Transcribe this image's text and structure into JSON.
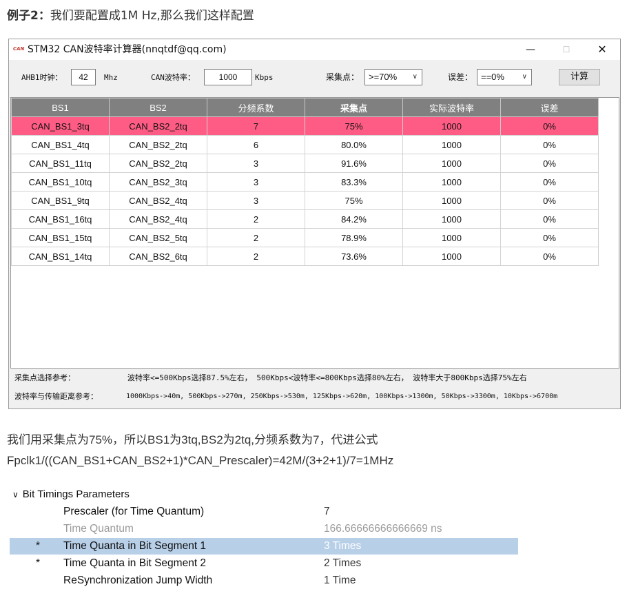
{
  "heading": {
    "bold": "例子2：",
    "text": "我们要配置成1M Hz,那么我们这样配置"
  },
  "window": {
    "logo": "CAN",
    "title": "STM32 CAN波特率计算器(nnqtdf@qq.com)",
    "controls": {
      "minimize": "—",
      "maximize": "☐",
      "close": "✕"
    },
    "ahb_label": "AHB1时钟：",
    "ahb_value": "42",
    "ahb_unit": "Mhz",
    "baud_label": "CAN波特率：",
    "baud_value": "1000",
    "baud_unit": "Kbps",
    "sample_label": "采集点：",
    "sample_value": ">=70%",
    "error_label": "误差：",
    "error_value": "==0%",
    "calc_button": "计算",
    "table": {
      "headers": [
        "BS1",
        "BS2",
        "分频系数",
        "采集点",
        "实际波特率",
        "误差"
      ],
      "rows": [
        [
          "CAN_BS1_3tq",
          "CAN_BS2_2tq",
          "7",
          "75%",
          "1000",
          "0%"
        ],
        [
          "CAN_BS1_4tq",
          "CAN_BS2_2tq",
          "6",
          "80.0%",
          "1000",
          "0%"
        ],
        [
          "CAN_BS1_11tq",
          "CAN_BS2_2tq",
          "3",
          "91.6%",
          "1000",
          "0%"
        ],
        [
          "CAN_BS1_10tq",
          "CAN_BS2_3tq",
          "3",
          "83.3%",
          "1000",
          "0%"
        ],
        [
          "CAN_BS1_9tq",
          "CAN_BS2_4tq",
          "3",
          "75%",
          "1000",
          "0%"
        ],
        [
          "CAN_BS1_16tq",
          "CAN_BS2_4tq",
          "2",
          "84.2%",
          "1000",
          "0%"
        ],
        [
          "CAN_BS1_15tq",
          "CAN_BS2_5tq",
          "2",
          "78.9%",
          "1000",
          "0%"
        ],
        [
          "CAN_BS1_14tq",
          "CAN_BS2_6tq",
          "2",
          "73.6%",
          "1000",
          "0%"
        ]
      ],
      "selected_row": 0,
      "selected_color": "#ff5c85"
    },
    "footer": {
      "sample_ref_label": "采集点选择参考：",
      "sample_ref_text": "波特率<=500Kbps选择87.5%左右，  500Kbps<波特率<=800Kbps选择80%左右，  波特率大于800Kbps选择75%左右",
      "distance_ref_label": "波特率与传输距离参考：",
      "distance_ref_text": "1000Kbps->40m, 500Kbps->270m, 250Kbps->530m, 125Kbps->620m, 100Kbps->1300m, 50Kbps->3300m, 10Kbps->6700m"
    }
  },
  "explanation": {
    "line1": "我们用采集点为75%，所以BS1为3tq,BS2为2tq,分频系数为7，代进公式",
    "line2": "Fpclk1/((CAN_BS1+CAN_BS2+1)*CAN_Prescaler)=42M/(3+2+1)/7=1MHz"
  },
  "properties": {
    "group_title": "Bit Timings Parameters",
    "rows": [
      {
        "star": "",
        "name": "Prescaler (for Time Quantum)",
        "value": "7",
        "dim": false,
        "highlight": false
      },
      {
        "star": "",
        "name": "Time Quantum",
        "value": "166.66666666666669 ns",
        "dim": true,
        "highlight": false
      },
      {
        "star": "*",
        "name": "Time Quanta in Bit Segment 1",
        "value": "3 Times",
        "dim": false,
        "highlight": true
      },
      {
        "star": "*",
        "name": "Time Quanta in Bit Segment 2",
        "value": "2 Times",
        "dim": false,
        "highlight": false
      },
      {
        "star": "",
        "name": "ReSynchronization Jump Width",
        "value": "1 Time",
        "dim": false,
        "highlight": false
      }
    ]
  }
}
